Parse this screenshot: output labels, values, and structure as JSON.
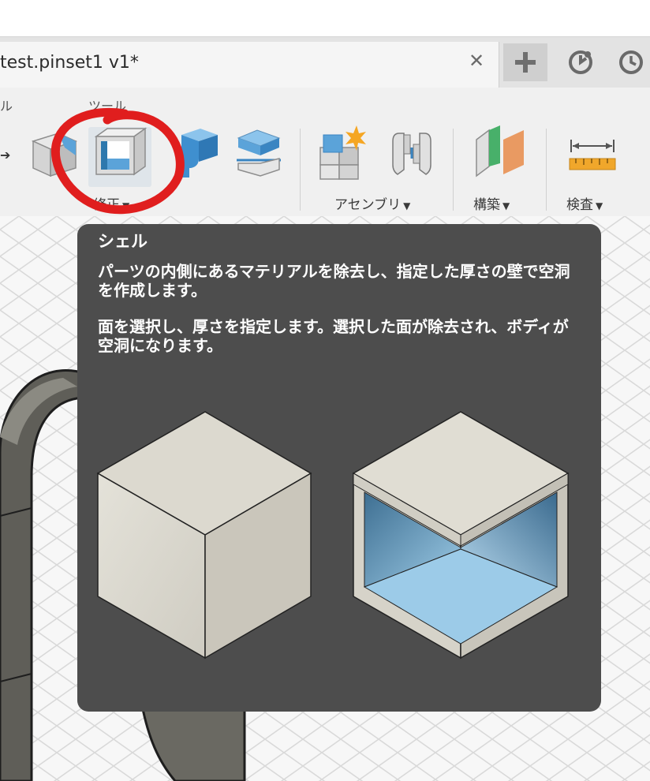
{
  "document_tab": {
    "title": "test.pinset1 v1*",
    "close_icon": "close-icon"
  },
  "header_buttons": [
    {
      "icon": "plus-icon"
    },
    {
      "icon": "job-status-icon"
    },
    {
      "icon": "clock-icon"
    }
  ],
  "workspace_tabs": [
    {
      "label": "ル"
    },
    {
      "label": "ツール"
    }
  ],
  "toolbar_groups": [
    {
      "label": "修正"
    },
    {
      "label": "アセンブリ"
    },
    {
      "label": "構築"
    },
    {
      "label": "検査"
    }
  ],
  "tooltip": {
    "title": "シェル",
    "description": [
      "パーツの内側にあるマテリアルを除去し、指定した厚さの壁で空洞を作成します。",
      "面を選択し、厚さを指定します。選択した面が除去され、ボディが空洞になります。"
    ]
  },
  "colors": {
    "accent_blue": "#5ba3d9",
    "annotation_red": "#e01e1e",
    "tooltip_bg": "#4d4d4d"
  }
}
